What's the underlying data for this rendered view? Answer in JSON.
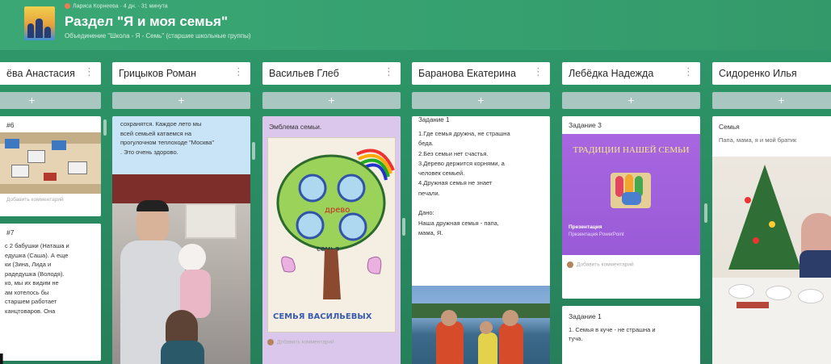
{
  "header": {
    "meta": "Лариса Корнеева · 4 дн. · 31 минута",
    "title": "Раздел \"Я и моя семья\"",
    "subtitle": "Объединение \"Школа - Я - Семь\" (старшие школьные группы)"
  },
  "columns": [
    {
      "name": "ёва Анастасия",
      "add": "+",
      "cards": [
        {
          "label": "#6",
          "comment": "Добавить комментарий"
        },
        {
          "label": "#7",
          "text": "с 2 бабушки (Наташа и\nедушка (Саша). А еще\nки (Зина, Лида и\nрадедушка (Володя).\nко, мы их видим не\nам хотелось бы\nстаршем работает\n канцтоваров. Она"
        }
      ]
    },
    {
      "name": "Грицыков Роман",
      "add": "+",
      "cards": [
        {
          "text": "сохранятся. Каждое лето мы\nвсей семьей катаемся на\nпрогулочном теплоходе \"Москва\"\n. Это очень здорово."
        }
      ]
    },
    {
      "name": "Васильев Глеб",
      "add": "+",
      "cards": [
        {
          "label": "Эмблема семьи.",
          "drawing_text": "СЕМЬЯ ВАСИЛЬЕВЫХ",
          "drawing_word": "семья",
          "drawing_tree": "древо",
          "comment": "Добавить комментарий"
        }
      ]
    },
    {
      "name": "Баранова Екатерина",
      "add": "+",
      "cards": [
        {
          "label": "Задание 1",
          "text": "1.Где семья дружна, не страшна\nбеда.\n2.Без семьи нет счастья.\n3.Дерево держится корнями, а\nчеловек семьей.\n4.Дружная семья не знает\nпечали.\n\nДано:\nНаша дружная семья - папа,\nмама, Я."
        }
      ]
    },
    {
      "name": "Лебёдка Надежда",
      "add": "+",
      "cards": [
        {
          "label": "Задание 3",
          "promo_title": "ТРАДИЦИИ НАШЕЙ СЕМЬИ",
          "promo_caption": "Презентация",
          "promo_sub": "Презентация PowerPoint",
          "comment": "Добавить комментарий"
        },
        {
          "label": "Задание 1",
          "text": "1. Семья в куче - не страшна и\nтуча."
        }
      ]
    },
    {
      "name": "Сидоренко Илья",
      "add": "+",
      "cards": [
        {
          "label": "Семья",
          "text": "Папа, мама, я и мой братик"
        }
      ]
    }
  ],
  "colors": {
    "bg": "#2f9a6a",
    "add": "#a9c6c1",
    "lilac": "#dcc7ec",
    "blue": "#c9e4f6",
    "promo": "#a86ae0"
  }
}
